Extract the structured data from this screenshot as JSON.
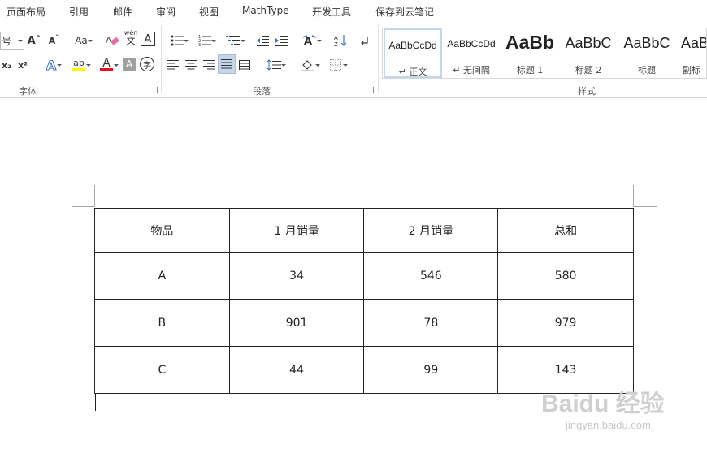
{
  "menu": [
    "页面布局",
    "引用",
    "邮件",
    "审阅",
    "视图",
    "MathType",
    "开发工具",
    "保存到云笔记"
  ],
  "ribbon": {
    "font": {
      "group_label": "字体",
      "size_label": "号",
      "change_case_label": "Aa",
      "phonetic_top": "wén",
      "phonetic_bottom": "文",
      "border_char": "A",
      "subscript": "x₂",
      "superscript": "x²",
      "effects": "A",
      "highlight": "ab",
      "font_color": "A",
      "shading": "A",
      "enclose": "字",
      "font_color_hex": "#e81123",
      "highlight_hex": "#ffff00"
    },
    "paragraph": {
      "group_label": "段落"
    },
    "styles": {
      "group_label": "样式",
      "items": [
        {
          "preview": "AaBbCcDd",
          "name": "↵ 正文"
        },
        {
          "preview": "AaBbCcDd",
          "name": "↵ 无间隔"
        },
        {
          "preview": "AaBb",
          "name": "标题 1"
        },
        {
          "preview": "AaBbC",
          "name": "标题 2"
        },
        {
          "preview": "AaBbC",
          "name": "标题"
        },
        {
          "preview": "AaB",
          "name": "副标"
        }
      ]
    }
  },
  "table": {
    "headers": [
      "物品",
      "1 月销量",
      "2 月销量",
      "总和"
    ],
    "rows": [
      [
        "A",
        "34",
        "546",
        "580"
      ],
      [
        "B",
        "901",
        "78",
        "979"
      ],
      [
        "C",
        "44",
        "99",
        "143"
      ]
    ]
  },
  "watermark": {
    "logo": "Baidu 经验",
    "url": "jingyan.baidu.com"
  }
}
